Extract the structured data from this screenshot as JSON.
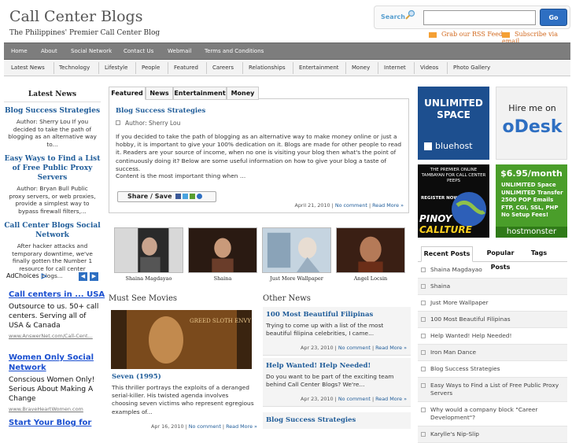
{
  "site": {
    "title": "Call Center Blogs",
    "tagline": "The Philippines' Premier Call Center Blog"
  },
  "search": {
    "label": "Search",
    "placeholder": "",
    "go_label": "Go"
  },
  "rss": {
    "grab_label": "Grab our RSS Feed",
    "email_label": "Subscribe via email"
  },
  "nav_primary": [
    "Home",
    "About",
    "Social Network",
    "Contact Us",
    "Webmail",
    "Terms and Conditions"
  ],
  "nav_categories": [
    "Latest News",
    "Technology",
    "Lifestyle",
    "People",
    "Featured",
    "Careers",
    "Relationships",
    "Entertainment",
    "Money",
    "Internet",
    "Videos",
    "Photo Gallery"
  ],
  "latest_news": {
    "heading": "Latest News",
    "items": [
      {
        "title": "Blog Success Strategies",
        "text": "Author: Sherry Lou If you decided to take the path of blogging as an alternative way to..."
      },
      {
        "title": "Easy Ways to Find a List of Free Public Proxy Servers",
        "text": "Author: Bryan Bull Public proxy servers, or web proxies, provide a simplest way to bypass firewall filters,..."
      },
      {
        "title": "Call Center Blogs Social Network",
        "text": "After hacker attacks and temporary downtime, we've finally gotten the Number 1 resource for call center blogs..."
      }
    ]
  },
  "adchoices": {
    "label": "AdChoices",
    "prev": "◀",
    "next": "▶",
    "ads": [
      {
        "title": "Call centers in ... USA",
        "text": "Outsource to us. 50+ call centers. Serving all of USA & Canada",
        "url": "www.AnswerNet.com/Call-Cent..."
      },
      {
        "title": "Women Only Social Network",
        "text": "Conscious Women Only! Serious About Making A Change",
        "url": "www.BraveHeartWomen.com"
      },
      {
        "title": "Start Your Blog for",
        "text": "",
        "url": ""
      }
    ]
  },
  "featured": {
    "tabs": [
      "Featured",
      "News",
      "Entertainment",
      "Money"
    ],
    "title": "Blog Success Strategies",
    "author": "Author: Sherry Lou",
    "body": "If you decided to take the path of blogging as an alternative way to make money online or just a hobby, it is important to give your 100% dedication on it. Blogs are made for other people to read it. Readers are your source of income, when no one is visiting your blog then what's the point of continuously doing it? Below are some useful information on how to give your blog a taste of success.",
    "body2": "Content is the most important thing when …",
    "share_label": "Share / Save",
    "date": "April 21, 2010",
    "comments": "No comment",
    "read_more": "Read More »"
  },
  "gallery": [
    {
      "caption": "Shaina Magdayao"
    },
    {
      "caption": "Shaina"
    },
    {
      "caption": "Just More Wallpaper"
    },
    {
      "caption": "Angel Locsin"
    }
  ],
  "must_see": {
    "heading": "Must See Movies",
    "poster_text": "GREED SLOTH ENVY",
    "title": "Seven (1995)",
    "text": "This thriller portrays the exploits of a deranged serial-killer. His twisted agenda involves choosing seven victims who represent egregious examples of...",
    "date": "Apr 16, 2010",
    "comments": "No comment",
    "read_more": "Read More »"
  },
  "other_news": {
    "heading": "Other News",
    "items": [
      {
        "title": "100 Most Beautiful Filipinas",
        "text": "Trying to come up with a list of the most beautiful filipina celebrities, I came...",
        "date": "Apr 23, 2010",
        "comments": "No comment",
        "read_more": "Read More »"
      },
      {
        "title": "Help Wanted! Help Needed!",
        "text": "Do you want to be part of the exciting team behind Call Center Blogs? We're...",
        "date": "Apr 23, 2010",
        "comments": "No comment",
        "read_more": "Read More »"
      },
      {
        "title": "Blog Success Strategies",
        "text": "",
        "date": "",
        "comments": "",
        "read_more": ""
      }
    ]
  },
  "ads_right": {
    "bluehost": {
      "line1": "UNLIMITED",
      "line2": "SPACE",
      "brand": "bluehost"
    },
    "odesk": {
      "line1": "Hire me on",
      "brand": "oDesk"
    },
    "pinoy": {
      "line1": "THE PREMIER ONLINE TAMBAYAN FOR CALL CENTER PEEPS",
      "line2": "REGISTER NOW!",
      "brand1": "PINOY",
      "brand2": "CALLTURE"
    },
    "hostmonster": {
      "price": "$6.95/month",
      "features": [
        "UNLIMITED Space",
        "UNLIMITED Transfer",
        "2500 POP Emails",
        "FTP, CGI, SSL, PHP",
        "No Setup Fees!"
      ],
      "brand": "hostmonster"
    }
  },
  "post_tabs": [
    "Recent Posts",
    "Popular Posts",
    "Tags"
  ],
  "recent_posts": [
    "Shaina Magdayao",
    "Shaina",
    "Just More Wallpaper",
    "100 Most Beautiful Filipinas",
    "Help Wanted! Help Needed!",
    "Iron Man Dance",
    "Blog Success Strategies",
    "Easy Ways to Find a List of Free Public Proxy Servers",
    "Why would a company block \"Career Development\"?",
    "Karylle's Nip-Slip"
  ],
  "colors": {
    "link": "#1f5c99",
    "nav_bg": "#7d7d7d",
    "accent": "#2e6fc2",
    "rss": "#f5a034"
  }
}
